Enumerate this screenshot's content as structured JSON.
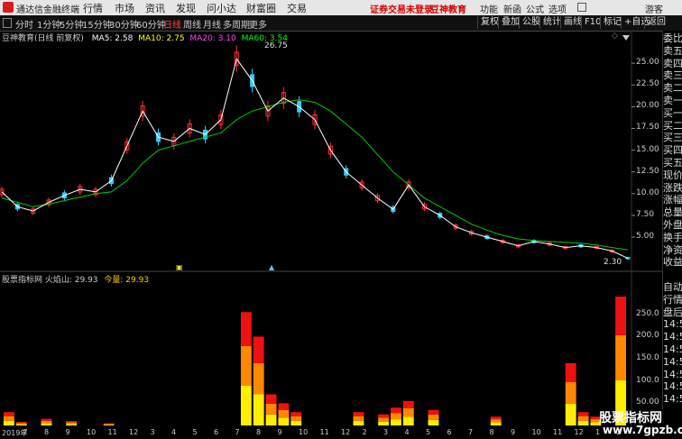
{
  "titlebar": {
    "app_name": "通达信金融终端",
    "menu": [
      "行情",
      "市场",
      "资讯",
      "发现",
      "问小达",
      "财富圈",
      "交易"
    ],
    "promo": [
      "证券交易未登录",
      "豆神教育"
    ],
    "right_menu": [
      "功能",
      "新函",
      "公式",
      "选项",
      "游客"
    ]
  },
  "toolbar": {
    "periods": [
      "分时",
      "1分钟",
      "5分钟",
      "15分钟",
      "30分钟",
      "60分钟",
      "日线",
      "周线",
      "月线",
      "多周期",
      "更多"
    ],
    "active": "日线",
    "right_buttons": [
      "复权",
      "叠加",
      "公股",
      "统计",
      "画线",
      "F10",
      "标记",
      "+自选",
      "返回"
    ]
  },
  "main_chart": {
    "stock_label": "豆神教育(日线 前复权)",
    "ma": [
      {
        "label": "MA5: 2.58",
        "color": "#ffffff"
      },
      {
        "label": "MA10: 2.75",
        "color": "#ffff00"
      },
      {
        "label": "MA20: 3.10",
        "color": "#ff00ff"
      },
      {
        "label": "MA60: 3.54",
        "color": "#00ff00"
      }
    ],
    "high_label": "26.75",
    "low_label": "2.30",
    "y_ticks": [
      "25.00",
      "22.50",
      "20.00",
      "17.50",
      "15.00",
      "12.50",
      "10.00",
      "7.50",
      "5.00"
    ]
  },
  "indicator": {
    "label": "股票指标网 火焰山: 29.93",
    "extra": "今量: 29.93",
    "y_ticks": [
      "250.0",
      "200.0",
      "150.0",
      "100.0",
      "50.00"
    ]
  },
  "x_axis": [
    "2019年",
    "7",
    "8",
    "9",
    "10",
    "11",
    "12",
    "3",
    "4",
    "5",
    "6",
    "7",
    "8",
    "9",
    "10",
    "11",
    "12",
    "2",
    "3",
    "4",
    "5",
    "6",
    "7",
    "8",
    "9",
    "10",
    "11",
    "12",
    "1",
    "2"
  ],
  "sidepanel": [
    "委比",
    "卖五",
    "卖四",
    "卖三",
    "卖二",
    "卖一",
    "买一",
    "买二",
    "买三",
    "买四",
    "买五",
    "现价",
    "涨跌",
    "涨幅",
    "总量",
    "外盘",
    "换手",
    "净资",
    "收益",
    "",
    "自动",
    "行情",
    "盘后",
    "14:50",
    "14:50",
    "14:50",
    "14:50",
    "14:50",
    "14:50",
    "14:50"
  ],
  "watermark": {
    "line1": "股票指标网",
    "line2": "www.7gpzb.com"
  },
  "chart_data": [
    {
      "type": "line",
      "title": "豆神教育(日线 前复权)",
      "y_range": [
        2.3,
        26.75
      ],
      "series": [
        {
          "name": "MA5",
          "values": [
            10.2,
            8.5,
            8.0,
            9.0,
            9.8,
            10.5,
            10.2,
            11.5,
            15.5,
            19.5,
            16.5,
            16.0,
            17.5,
            16.8,
            18.5,
            25.5,
            23.0,
            19.5,
            21.0,
            20.0,
            18.5,
            15.0,
            12.5,
            11.0,
            9.5,
            8.2,
            11.0,
            8.5,
            7.5,
            6.2,
            5.5,
            5.0,
            4.5,
            4.0,
            4.5,
            4.2,
            3.8,
            4.0,
            3.8,
            3.4,
            2.58
          ]
        },
        {
          "name": "MA60",
          "values": [
            9.5,
            9.0,
            8.5,
            8.8,
            9.2,
            9.6,
            10.0,
            10.2,
            11.5,
            13.5,
            15.0,
            15.5,
            16.0,
            16.5,
            17.0,
            18.5,
            19.5,
            20.0,
            20.5,
            20.8,
            20.5,
            19.5,
            18.0,
            16.5,
            14.5,
            12.5,
            11.0,
            9.5,
            8.5,
            7.5,
            6.5,
            5.8,
            5.2,
            4.8,
            4.6,
            4.5,
            4.4,
            4.3,
            4.1,
            3.8,
            3.54
          ]
        }
      ]
    },
    {
      "type": "bar",
      "title": "火焰山",
      "y_range": [
        0,
        290
      ],
      "values": [
        30,
        8,
        0,
        15,
        0,
        10,
        0,
        0,
        5,
        0,
        0,
        0,
        0,
        0,
        0,
        0,
        0,
        0,
        0,
        255,
        200,
        70,
        50,
        30,
        0,
        0,
        0,
        0,
        30,
        0,
        25,
        40,
        55,
        0,
        35,
        0,
        0,
        0,
        0,
        20,
        0,
        0,
        0,
        0,
        0,
        140,
        30,
        20,
        0,
        290
      ]
    }
  ]
}
